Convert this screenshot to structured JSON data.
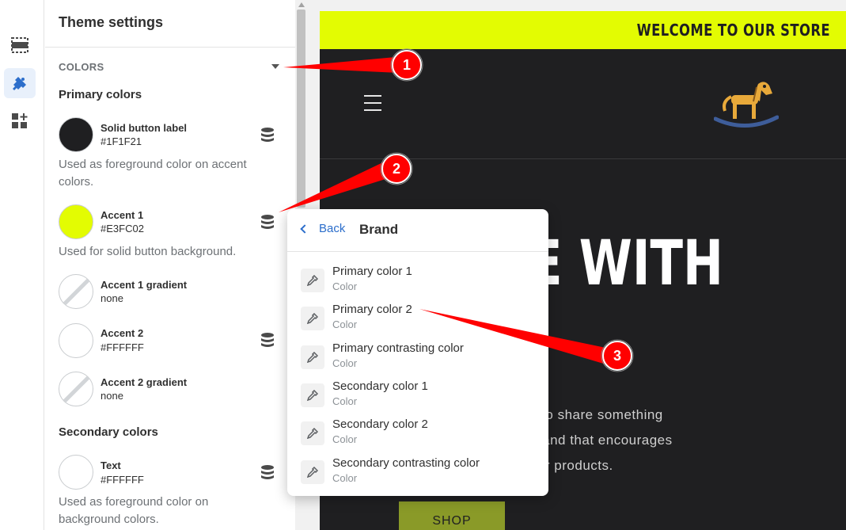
{
  "rail": {
    "items": [
      {
        "name": "sections",
        "icon": "sections-icon"
      },
      {
        "name": "theme-settings",
        "icon": "paintbrush-icon",
        "active": true
      },
      {
        "name": "apps",
        "icon": "apps-add-icon"
      }
    ]
  },
  "panel": {
    "title": "Theme settings",
    "section_label": "COLORS",
    "primary_title": "Primary colors",
    "secondary_title": "Secondary colors",
    "settings": [
      {
        "name": "Solid button label",
        "value": "#1F1F21",
        "color": "#1f1f21",
        "help": "Used as foreground color on accent colors."
      },
      {
        "name": "Accent 1",
        "value": "#E3FC02",
        "color": "#e3fc02",
        "help": "Used for solid button background."
      },
      {
        "name": "Accent 1 gradient",
        "value": "none"
      },
      {
        "name": "Accent 2",
        "value": "#FFFFFF",
        "color": "#ffffff"
      },
      {
        "name": "Accent 2 gradient",
        "value": "none"
      },
      {
        "name": "Text",
        "value": "#FFFFFF",
        "color": "#ffffff",
        "help": "Used as foreground color on background colors."
      }
    ]
  },
  "preview": {
    "announcement": "WELCOME TO OUR STORE",
    "hero_title": "E WITH",
    "hero_body": [
      "e to share something",
      "brand that encourages",
      "our products."
    ],
    "shop_button": "SHOP",
    "colors": {
      "accent": "#e3fc02",
      "background": "#1f1f21",
      "button": "#8a9a28"
    }
  },
  "popover": {
    "back_label": "Back",
    "title": "Brand",
    "items": [
      {
        "label": "Primary color 1",
        "sub": "Color"
      },
      {
        "label": "Primary color 2",
        "sub": "Color"
      },
      {
        "label": "Primary contrasting color",
        "sub": "Color"
      },
      {
        "label": "Secondary color 1",
        "sub": "Color"
      },
      {
        "label": "Secondary color 2",
        "sub": "Color"
      },
      {
        "label": "Secondary contrasting color",
        "sub": "Color"
      }
    ]
  },
  "annotations": {
    "markers": [
      "1",
      "2",
      "3"
    ],
    "color": "#ff0000"
  }
}
